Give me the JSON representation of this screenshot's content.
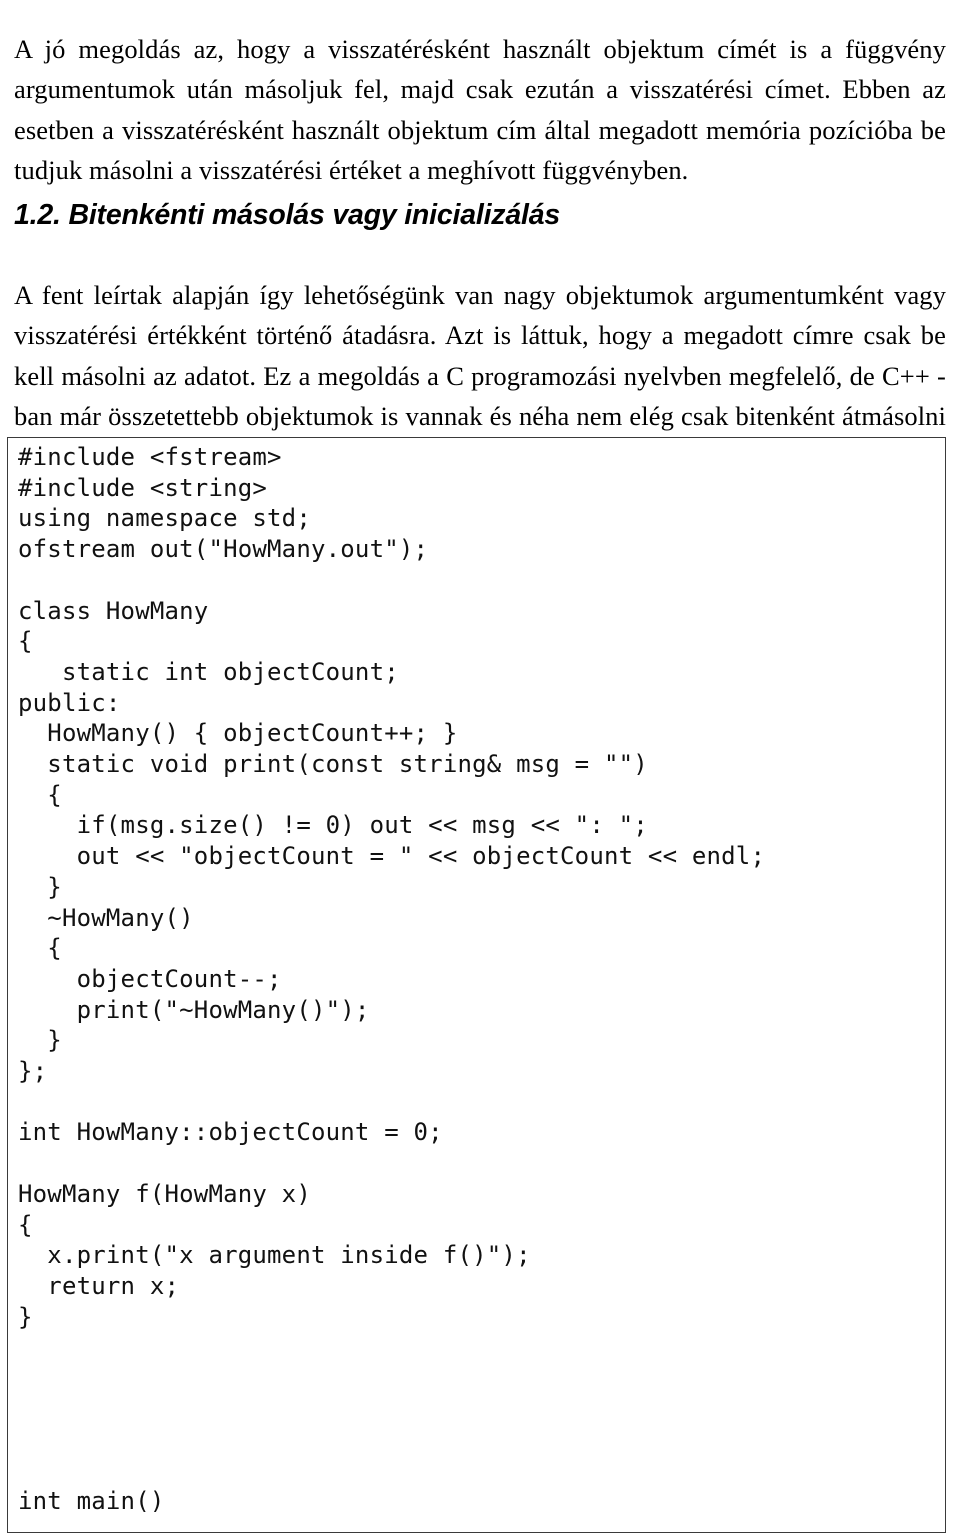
{
  "document": {
    "language": "hu",
    "intro_paragraph": "A jó megoldás az, hogy a visszatérésként használt objektum címét is a függvény argumentumok után másoljuk fel, majd csak ezután a visszatérési címet. Ebben az esetben a visszatérésként használt objektum cím által megadott memória pozícióba be tudjuk másolni a visszatérési értéket a meghívott függvényben.",
    "heading": "1.2. Bitenkénti másolás vagy inicializálás",
    "body_paragraph": "A fent leírtak alapján így lehetőségünk van nagy objektumok argumentumként vagy visszatérési értékként történő átadásra. Azt is láttuk, hogy a megadott címre csak be kell másolni az adatot. Ez a megoldás a C programozási nyelvben megfelelő, de C++ - ban már összetettebb objektumok is vannak és néha nem elég csak bitenként átmásolni az objektumokat. Nézzük az alábbi példát:",
    "code_listing": "#include <fstream>\n#include <string>\nusing namespace std;\nofstream out(\"HowMany.out\");\n\nclass HowMany\n{\n   static int objectCount;\npublic:\n  HowMany() { objectCount++; }\n  static void print(const string& msg = \"\")\n  {\n    if(msg.size() != 0) out << msg << \": \";\n    out << \"objectCount = \" << objectCount << endl;\n  }\n  ~HowMany()\n  {\n    objectCount--;\n    print(\"~HowMany()\");\n  }\n};\n\nint HowMany::objectCount = 0;\n\nHowMany f(HowMany x)\n{\n  x.print(\"x argument inside f()\");\n  return x;\n}\n\n\n\n\n\nint main()",
    "colors": {
      "text": "#000000",
      "code_text": "#111111",
      "code_border": "#3a3a3a",
      "page_background": "#ffffff"
    }
  }
}
